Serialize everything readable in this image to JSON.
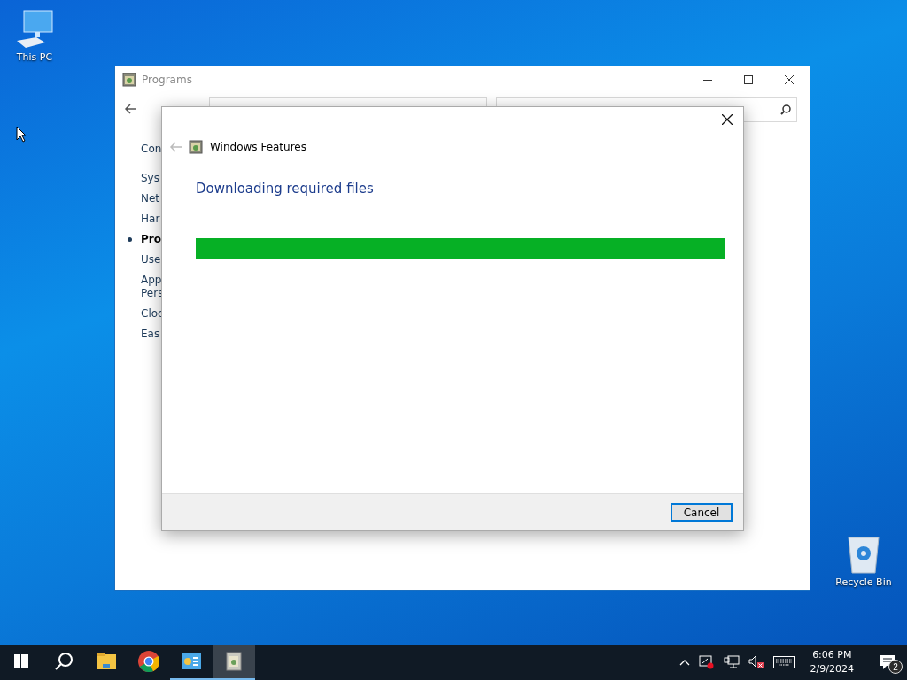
{
  "desktop_icons": [
    {
      "kind": "computer",
      "label": "This PC"
    },
    {
      "kind": "recycle",
      "label": "Recycle Bin"
    }
  ],
  "programs_window": {
    "title": "Programs",
    "sidebar_items": [
      {
        "lines": [
          "Con"
        ],
        "selected": false
      },
      {
        "lines": [
          "Sys"
        ],
        "selected": false
      },
      {
        "lines": [
          "Net"
        ],
        "selected": false
      },
      {
        "lines": [
          "Har"
        ],
        "selected": false
      },
      {
        "lines": [
          "Pro"
        ],
        "selected": true
      },
      {
        "lines": [
          "Use"
        ],
        "selected": false
      },
      {
        "lines": [
          "App",
          "Pers"
        ],
        "selected": false
      },
      {
        "lines": [
          "Cloc"
        ],
        "selected": false
      },
      {
        "lines": [
          "Eas"
        ],
        "selected": false
      }
    ]
  },
  "dialog": {
    "title": "Windows Features",
    "heading": "Downloading required files",
    "progress": {
      "level": 1
    },
    "buttons": [
      {
        "label": "Cancel",
        "default": true
      }
    ]
  },
  "taskbar": {
    "apps": [
      {
        "kind": "start",
        "running": false,
        "selected": false
      },
      {
        "kind": "search",
        "running": false,
        "selected": false
      },
      {
        "kind": "folder",
        "running": false,
        "selected": false
      },
      {
        "kind": "chrome",
        "running": false,
        "selected": false
      },
      {
        "kind": "panel",
        "running": true,
        "selected": false
      },
      {
        "kind": "features",
        "running": true,
        "selected": true
      }
    ],
    "clock": {
      "time": "6:06 PM",
      "date": "2/9/2024"
    },
    "notifications": {
      "count": "2"
    }
  }
}
